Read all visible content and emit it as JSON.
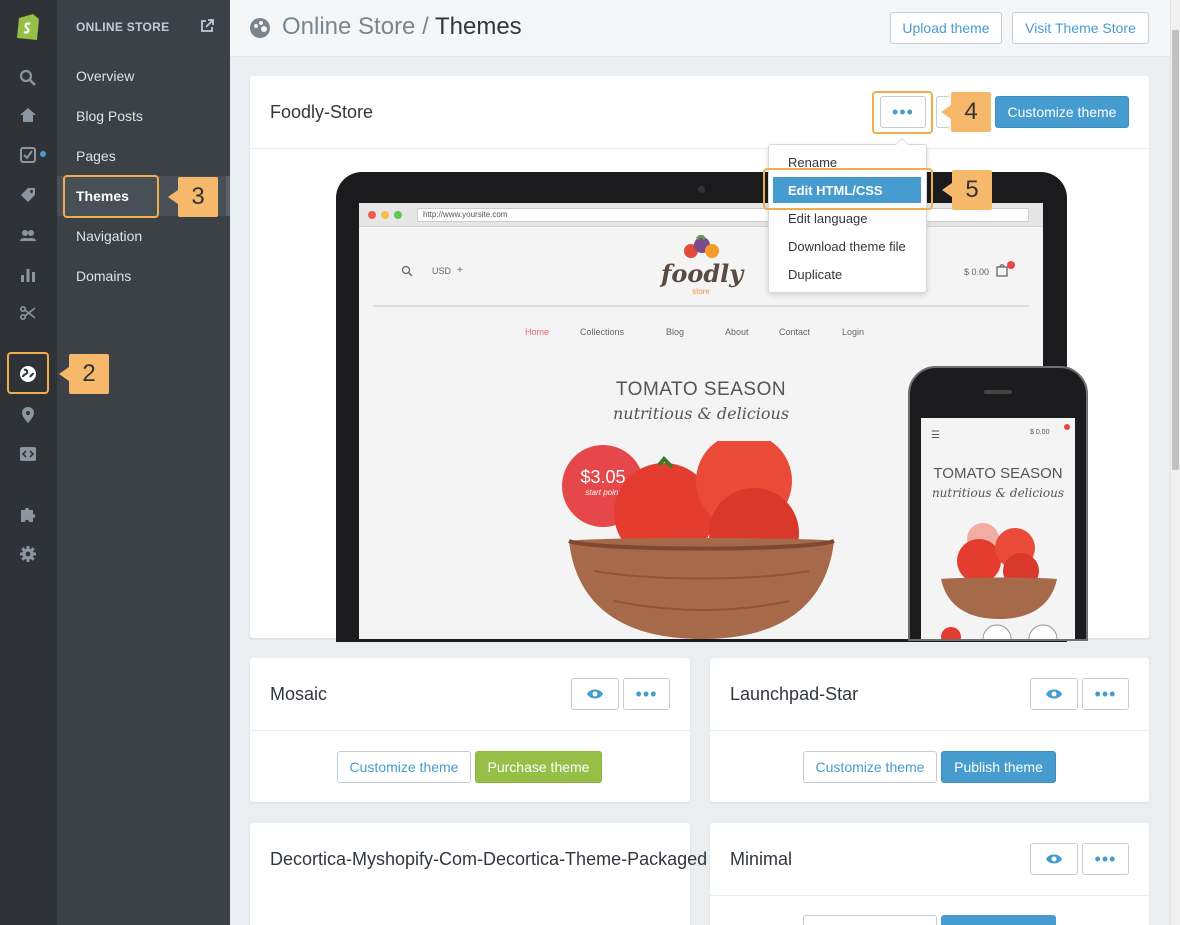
{
  "sidebar": {
    "header": "ONLINE STORE",
    "items": [
      {
        "label": "Overview"
      },
      {
        "label": "Blog Posts"
      },
      {
        "label": "Pages"
      },
      {
        "label": "Themes"
      },
      {
        "label": "Navigation"
      },
      {
        "label": "Domains"
      }
    ]
  },
  "header": {
    "parent": "Online Store",
    "separator": " / ",
    "current": "Themes",
    "upload_label": "Upload theme",
    "visit_label": "Visit Theme Store"
  },
  "current_theme": {
    "name": "Foodly-Store",
    "more_label": "•••",
    "customize_label": "Customize theme",
    "menu": [
      "Rename",
      "Edit HTML/CSS",
      "Edit language",
      "Download theme file",
      "Duplicate"
    ],
    "preview": {
      "url": "http://www.yoursite.com",
      "currency": "USD",
      "cart": "$ 0.00",
      "nav": [
        "Home",
        "Collections",
        "Blog",
        "About",
        "Contact",
        "Login"
      ],
      "hero_title": "TOMATO SEASON",
      "hero_subtitle": "nutritious & delicious",
      "price": "$3.05",
      "price_note": "start point",
      "logo_text": "foodly",
      "logo_sub": "store"
    }
  },
  "themes": [
    {
      "name": "Mosaic",
      "btn1": "Customize theme",
      "btn2": "Purchase theme"
    },
    {
      "name": "Launchpad-Star",
      "btn1": "Customize theme",
      "btn2": "Publish theme"
    },
    {
      "name": "Decortica-Myshopify-Com-Decortica-Theme-Packaged"
    },
    {
      "name": "Minimal"
    }
  ],
  "callouts": [
    "2",
    "3",
    "4",
    "5"
  ],
  "colors": {
    "accent": "#479ccf",
    "green": "#96bf48",
    "highlight": "#f0ad4e",
    "callout": "#f6b96b",
    "rail": "#2f3337"
  }
}
